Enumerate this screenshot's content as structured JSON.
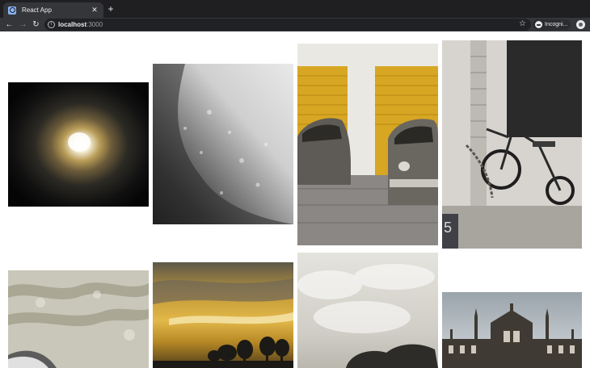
{
  "browser": {
    "tab": {
      "title": "React App",
      "close_glyph": "✕",
      "favicon": "react-app-favicon"
    },
    "new_tab_glyph": "+",
    "nav": {
      "back": "←",
      "forward": "→",
      "reload": "↻"
    },
    "address": {
      "host": "localhost",
      "port": ":3000",
      "info_glyph": "i"
    },
    "bookmark_glyph": "☆",
    "profile": {
      "label": "Incogni..."
    },
    "colors": {
      "tabstrip": "#1f1f21",
      "toolbar": "#35363a",
      "omnibox": "#202124",
      "text": "#e8eaed"
    }
  },
  "gallery": {
    "photos": [
      {
        "name": "photo-light-tunnel",
        "subject": "bright light in dark tunnel"
      },
      {
        "name": "photo-water-droplets",
        "subject": "water droplets on glass"
      },
      {
        "name": "photo-vintage-cars",
        "subject": "two vintage cars before yellow garage doors"
      },
      {
        "name": "photo-tricycle",
        "subject": "old tricycle chained to wall"
      },
      {
        "name": "photo-aerial-landscape",
        "subject": "aerial landscape from airplane window"
      },
      {
        "name": "photo-golden-sunset",
        "subject": "golden sky with silhouetted trees"
      },
      {
        "name": "photo-cloudy-sky",
        "subject": "cloudy sky"
      },
      {
        "name": "photo-gothic-building",
        "subject": "gothic building facade"
      }
    ]
  }
}
